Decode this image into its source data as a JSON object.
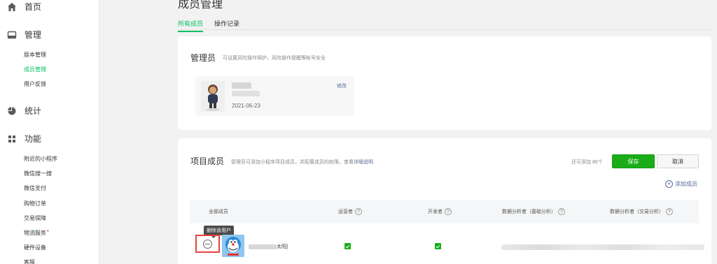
{
  "sidebar": {
    "home": {
      "label": "首页",
      "icon": "home-icon"
    },
    "manage": {
      "label": "管理",
      "icon": "manage-icon",
      "items": [
        "版本管理",
        "成员管理",
        "用户反馈"
      ],
      "active_index": 1
    },
    "stats": {
      "label": "统计",
      "icon": "stats-icon"
    },
    "features": {
      "label": "功能",
      "icon": "features-icon",
      "items": [
        "附近的小程序",
        "微信搜一搜",
        "微信支付",
        "购物订单",
        "交易保障",
        "物流服务",
        "硬件设备",
        "客服"
      ],
      "red_dot_item": "物流服务"
    }
  },
  "page": {
    "title": "成员管理",
    "tabs": [
      "所有成员",
      "操作记录"
    ],
    "active_tab": 0
  },
  "admin_card": {
    "title": "管理员",
    "desc": "可设置风险操作保护、风险操作提醒等帐号安全",
    "date": "2021-06-23",
    "edit_label": "修改"
  },
  "members_card": {
    "title": "项目成员",
    "desc": "管理员可添加小程序项目成员，并配置成员的权限，查看",
    "desc_link": "详细说明",
    "quota": "还可添加 86个",
    "save_label": "保存",
    "cancel_label": "取消",
    "add_label": "添加成员",
    "columns": [
      "全部成员",
      "运营者",
      "开发者",
      "数据分析者（基础分析）",
      "数据分析者（交易分析）"
    ],
    "rows": [
      {
        "name": "太阳]",
        "tooltip": "删除该用户",
        "operator": true,
        "developer": true
      }
    ]
  },
  "colors": {
    "accent": "#07c160",
    "button_green": "#1aad19",
    "link": "#576b95",
    "highlight_red": "#e64340"
  }
}
